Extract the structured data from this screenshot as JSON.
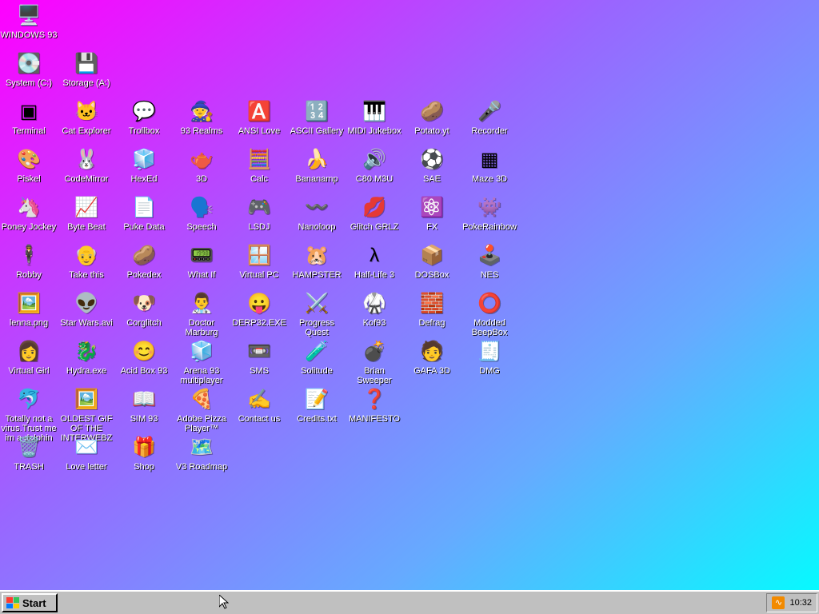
{
  "desktop": {
    "icons": [
      {
        "id": "windows-93",
        "label": "WINDOWS 93",
        "glyph": "🖥️",
        "icon": "computer-icon"
      },
      {
        "id": "system-c",
        "label": "System (C:)",
        "glyph": "💽",
        "icon": "drive-icon"
      },
      {
        "id": "storage-a",
        "label": "Storage (A:)",
        "glyph": "💾",
        "icon": "floppy-drive-icon"
      },
      {
        "id": "terminal",
        "label": "Terminal",
        "glyph": "▣",
        "icon": "terminal-icon"
      },
      {
        "id": "cat-explorer",
        "label": "Cat Explorer",
        "glyph": "🐱",
        "icon": "cat-globe-icon"
      },
      {
        "id": "trollbox",
        "label": "Trollbox",
        "glyph": "💬",
        "icon": "chat-bubble-icon"
      },
      {
        "id": "93-realms",
        "label": "93 Realms",
        "glyph": "🧙",
        "icon": "realms-icon"
      },
      {
        "id": "ansi-love",
        "label": "ANSI Love",
        "glyph": "🅰️",
        "icon": "ansi-icon"
      },
      {
        "id": "ascii-gallery",
        "label": "ASCII Gallery",
        "glyph": "🔢",
        "icon": "ascii-icon"
      },
      {
        "id": "midi-jukebox",
        "label": "MIDI Jukebox",
        "glyph": "🎹",
        "icon": "piano-icon"
      },
      {
        "id": "potato-yt",
        "label": "Potato.yt",
        "glyph": "🥔",
        "icon": "potato-icon"
      },
      {
        "id": "recorder",
        "label": "Recorder",
        "glyph": "🎤",
        "icon": "microphone-icon"
      },
      {
        "id": "piskel",
        "label": "Piskel",
        "glyph": "🎨",
        "icon": "palette-icon"
      },
      {
        "id": "codemirror",
        "label": "CodeMirror",
        "glyph": "🐰",
        "icon": "codemirror-icon"
      },
      {
        "id": "hexed",
        "label": "HexEd",
        "glyph": "🧊",
        "icon": "hexed-icon"
      },
      {
        "id": "3d",
        "label": "3D",
        "glyph": "🫖",
        "icon": "teapot-icon"
      },
      {
        "id": "calc",
        "label": "Calc",
        "glyph": "🧮",
        "icon": "calculator-icon"
      },
      {
        "id": "bananamp",
        "label": "Bananamp",
        "glyph": "🍌",
        "icon": "banana-icon"
      },
      {
        "id": "c80-m3u",
        "label": "C80.M3U",
        "glyph": "🔊",
        "icon": "speaker-file-icon"
      },
      {
        "id": "sae",
        "label": "SAE",
        "glyph": "⚽",
        "icon": "amiga-ball-icon"
      },
      {
        "id": "maze-3d",
        "label": "Maze 3D",
        "glyph": "▦",
        "icon": "maze-icon"
      },
      {
        "id": "poney-jockey",
        "label": "Poney Jockey",
        "glyph": "🦄",
        "icon": "pony-icon"
      },
      {
        "id": "byte-beat",
        "label": "Byte Beat",
        "glyph": "📈",
        "icon": "bytebeat-icon"
      },
      {
        "id": "puke-data",
        "label": "Puke Data",
        "glyph": "📄",
        "icon": "pd-icon"
      },
      {
        "id": "speech",
        "label": "Speech",
        "glyph": "🗣️",
        "icon": "speech-face-icon"
      },
      {
        "id": "lsdj",
        "label": "LSDJ",
        "glyph": "🎮",
        "icon": "lsdj-icon"
      },
      {
        "id": "nanoloop",
        "label": "Nanoloop",
        "glyph": "〰️",
        "icon": "wave-icon"
      },
      {
        "id": "glitch-grlz",
        "label": "Glitch GRLZ",
        "glyph": "💋",
        "icon": "lips-icon"
      },
      {
        "id": "fx",
        "label": "FX",
        "glyph": "⚛️",
        "icon": "atom-icon"
      },
      {
        "id": "pokerainbow",
        "label": "PokeRainbow",
        "glyph": "👾",
        "icon": "sprites-icon"
      },
      {
        "id": "robby",
        "label": "Robby",
        "glyph": "🕴️",
        "icon": "stick-figure-icon"
      },
      {
        "id": "take-this",
        "label": "Take this",
        "glyph": "👴",
        "icon": "old-man-icon"
      },
      {
        "id": "pokedex",
        "label": "Pokedex",
        "glyph": "🥔",
        "icon": "pokedex-icon"
      },
      {
        "id": "what-if",
        "label": "What If",
        "glyph": "📟",
        "icon": "what-if-icon"
      },
      {
        "id": "virtual-pc",
        "label": "Virtual PC",
        "glyph": "🪟",
        "icon": "window-cursor-icon"
      },
      {
        "id": "hampster",
        "label": "HAMPSTER",
        "glyph": "🐹",
        "icon": "hamster-icon"
      },
      {
        "id": "half-life-3",
        "label": "Half-Life 3",
        "glyph": "λ",
        "icon": "lambda-icon"
      },
      {
        "id": "dosbox",
        "label": "DOSBox",
        "glyph": "📦",
        "icon": "box-icon"
      },
      {
        "id": "nes",
        "label": "NES",
        "glyph": "🕹️",
        "icon": "nes-console-icon"
      },
      {
        "id": "lenna-png",
        "label": "lenna.png",
        "glyph": "🖼️",
        "icon": "image-file-icon"
      },
      {
        "id": "star-wars-avi",
        "label": "Star Wars.avi",
        "glyph": "👽",
        "icon": "yoda-icon"
      },
      {
        "id": "corglitch",
        "label": "Corglitch",
        "glyph": "🐶",
        "icon": "corgi-icon"
      },
      {
        "id": "doctor-marburg",
        "label": "Doctor Marburg",
        "glyph": "👨‍⚕️",
        "icon": "doctor-icon"
      },
      {
        "id": "derp32-exe",
        "label": "DERP32.EXE",
        "glyph": "😛",
        "icon": "derp-monitor-icon"
      },
      {
        "id": "progress-quest",
        "label": "Progress Quest",
        "glyph": "⚔️",
        "icon": "swords-icon"
      },
      {
        "id": "kof93",
        "label": "Kof93",
        "glyph": "🥋",
        "icon": "fighter-icon"
      },
      {
        "id": "defrag",
        "label": "Defrag",
        "glyph": "🧱",
        "icon": "defrag-icon"
      },
      {
        "id": "modded-beepbox",
        "label": "Modded BeepBox",
        "glyph": "⭕",
        "icon": "ring-icon"
      },
      {
        "id": "virtual-girl",
        "label": "Virtual Girl",
        "glyph": "👩",
        "icon": "face-icon"
      },
      {
        "id": "hydra-exe",
        "label": "Hydra.exe",
        "glyph": "🐉",
        "icon": "dragon-icon"
      },
      {
        "id": "acid-box-93",
        "label": "Acid Box 93",
        "glyph": "😊",
        "icon": "smiley-icon"
      },
      {
        "id": "arena-93-multiplayer",
        "label": "Arena 93 multiplayer",
        "glyph": "🧊",
        "icon": "cube-icon"
      },
      {
        "id": "sms",
        "label": "SMS",
        "glyph": "📼",
        "icon": "sms-console-icon"
      },
      {
        "id": "solitude",
        "label": "Solitude",
        "glyph": "🧪",
        "icon": "jar-icon"
      },
      {
        "id": "brian-sweeper",
        "label": "Brian Sweeper",
        "glyph": "💣",
        "icon": "mine-icon"
      },
      {
        "id": "gafa-3d",
        "label": "GAFA 3D",
        "glyph": "🧑",
        "icon": "pixel-face-icon"
      },
      {
        "id": "dmg",
        "label": "DMG",
        "glyph": "🧾",
        "icon": "dmg-icon"
      },
      {
        "id": "totally-not-a-virus",
        "label": "Totally not a virus.Trust me im a dolphin",
        "glyph": "🐬",
        "icon": "dolphin-icon"
      },
      {
        "id": "oldest-gif",
        "label": "OLDEST GIF OF THE INTERWEBZ",
        "glyph": "🖼️",
        "icon": "gif-file-icon"
      },
      {
        "id": "sim-93",
        "label": "SIM 93",
        "glyph": "📖",
        "icon": "book-icon"
      },
      {
        "id": "adobe-pizza-player",
        "label": "Adobe Pizza Player™",
        "glyph": "🍕",
        "icon": "pizza-icon"
      },
      {
        "id": "contact-us",
        "label": "Contact us",
        "glyph": "✍️",
        "icon": "contact-icon"
      },
      {
        "id": "credits-txt",
        "label": "Credits.txt",
        "glyph": "📝",
        "icon": "text-file-icon"
      },
      {
        "id": "manifesto",
        "label": "MANIFESTO",
        "glyph": "❓",
        "icon": "question-icon"
      },
      {
        "id": "trash",
        "label": "TRASH",
        "glyph": "🗑️",
        "icon": "trash-icon"
      },
      {
        "id": "love-letter",
        "label": "Love letter",
        "glyph": "✉️",
        "icon": "envelope-icon"
      },
      {
        "id": "shop",
        "label": "Shop",
        "glyph": "🎁",
        "icon": "gift-icon"
      },
      {
        "id": "v3-roadmap",
        "label": "V3 Roadmap",
        "glyph": "🗺️",
        "icon": "map-icon"
      }
    ]
  },
  "taskbar": {
    "start_label": "Start",
    "clock": "10:32",
    "rss_glyph": "∿"
  },
  "colors": {
    "gradient_start": "#ff00ff",
    "gradient_end": "#00ffff",
    "taskbar": "#c0c0c0"
  }
}
